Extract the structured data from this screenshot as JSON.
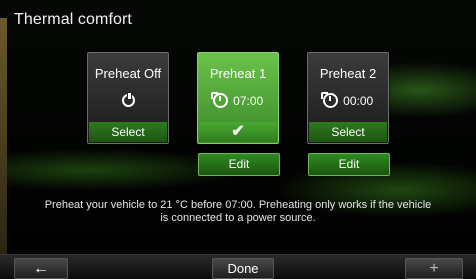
{
  "title": "Thermal comfort",
  "cards": [
    {
      "name": "Preheat Off",
      "icon": "power-icon",
      "time": "",
      "action": "Select"
    },
    {
      "name": "Preheat 1",
      "icon": "clock-icon",
      "time": "07:00",
      "action": "✔"
    },
    {
      "name": "Preheat 2",
      "icon": "clock-icon",
      "time": "00:00",
      "action": "Select"
    }
  ],
  "edit_label": "Edit",
  "info": "Preheat your vehicle to 21 °C before 07:00. Preheating only works if the vehicle is connected to a power source.",
  "footer": {
    "back": "←",
    "done": "Done",
    "add": "+"
  },
  "colors": {
    "active_card": "#5db43f",
    "select_bar": "#2b7420"
  }
}
